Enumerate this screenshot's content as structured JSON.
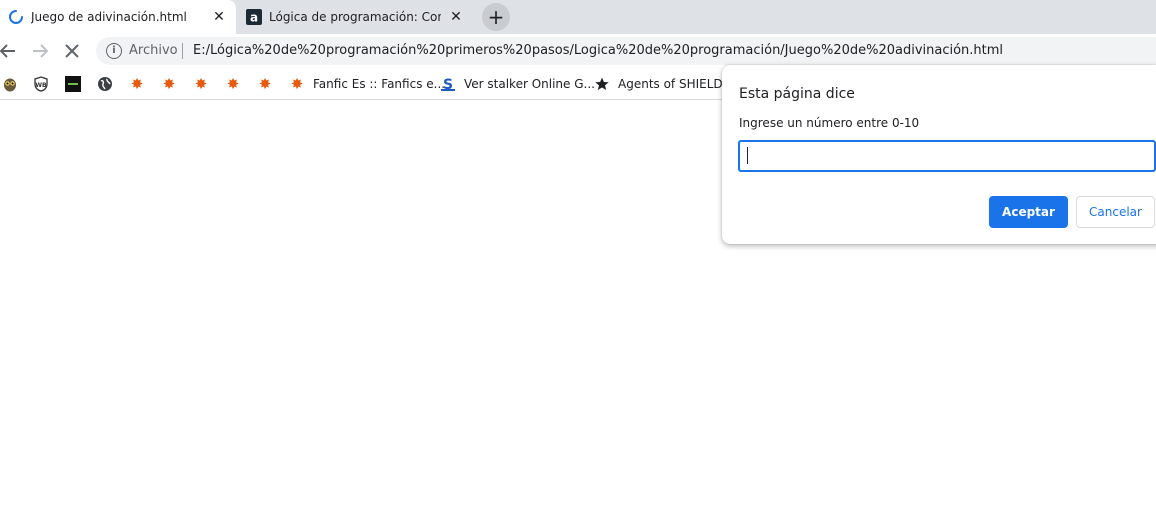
{
  "tabs": [
    {
      "title": "Juego de adivinación.html",
      "state": "loading"
    },
    {
      "title": "Lógica de programación: Concep"
    }
  ],
  "toolbar": {
    "security_label": "Archivo",
    "url": "E:/Lógica%20de%20programación%20primeros%20pasos/Logica%20de%20programación/Juego%20de%20adivinación.html"
  },
  "bookmarks": [
    {
      "icon": "owl-icon",
      "label": ""
    },
    {
      "icon": "wb-shield-icon",
      "label": ""
    },
    {
      "icon": "dark-site-icon",
      "label": ""
    },
    {
      "icon": "globe-icon",
      "label": ""
    },
    {
      "icon": "orange-star-icon",
      "label": ""
    },
    {
      "icon": "orange-star-icon",
      "label": ""
    },
    {
      "icon": "orange-star-icon",
      "label": ""
    },
    {
      "icon": "orange-star-icon",
      "label": ""
    },
    {
      "icon": "orange-star-icon",
      "label": ""
    },
    {
      "icon": "orange-star-icon",
      "label": "Fanfic Es :: Fanfics e..."
    },
    {
      "icon": "s-site-icon",
      "label": "Ver stalker Online G..."
    },
    {
      "icon": "black-star-icon",
      "label": "Agents of SHIELD C"
    }
  ],
  "dialog": {
    "title": "Esta página dice",
    "message": "Ingrese un número entre 0-10",
    "input_value": "",
    "ok_label": "Aceptar",
    "cancel_label": "Cancelar"
  },
  "colors": {
    "accent": "#1a73e8",
    "tabstrip": "#dee1e6",
    "omnibox": "#f1f3f4",
    "bookmark_star": "#e8590c"
  }
}
